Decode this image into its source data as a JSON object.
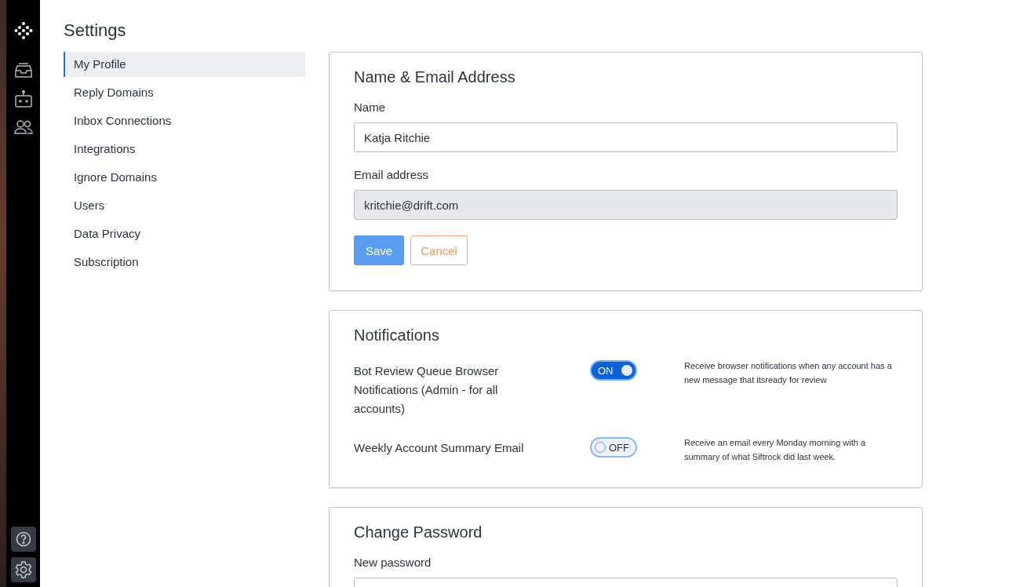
{
  "page_title": "Settings",
  "nav": [
    {
      "label": "My Profile",
      "selected": true
    },
    {
      "label": "Reply Domains",
      "selected": false
    },
    {
      "label": "Inbox Connections",
      "selected": false
    },
    {
      "label": "Integrations",
      "selected": false
    },
    {
      "label": "Ignore Domains",
      "selected": false
    },
    {
      "label": "Users",
      "selected": false
    },
    {
      "label": "Data Privacy",
      "selected": false
    },
    {
      "label": "Subscription",
      "selected": false
    }
  ],
  "profile": {
    "title": "Name & Email Address",
    "fields": [
      {
        "label": "Name",
        "value": "Katja Ritchie",
        "disabled": false
      },
      {
        "label": "Email address",
        "value": "kritchie@drift.com",
        "disabled": true
      }
    ],
    "buttons": [
      {
        "label": "Save",
        "kind": "primary"
      },
      {
        "label": "Cancel",
        "kind": "secondary"
      }
    ]
  },
  "notifications": {
    "title": "Notifications",
    "items": [
      {
        "label": "Bot Review Queue Browser Notifications (Admin - for all accounts)",
        "on": true,
        "toggle_text": "ON",
        "description": "Receive browser notifications when any account has a new message that itsready for review"
      },
      {
        "label": "Weekly Account Summary Email",
        "on": false,
        "toggle_text": "OFF",
        "description": "Receive an email every Monday morning with a summary of what Siftrock did last week."
      }
    ]
  },
  "password": {
    "title": "Change Password",
    "fields": [
      {
        "label": "New password",
        "disabled": false
      }
    ]
  }
}
